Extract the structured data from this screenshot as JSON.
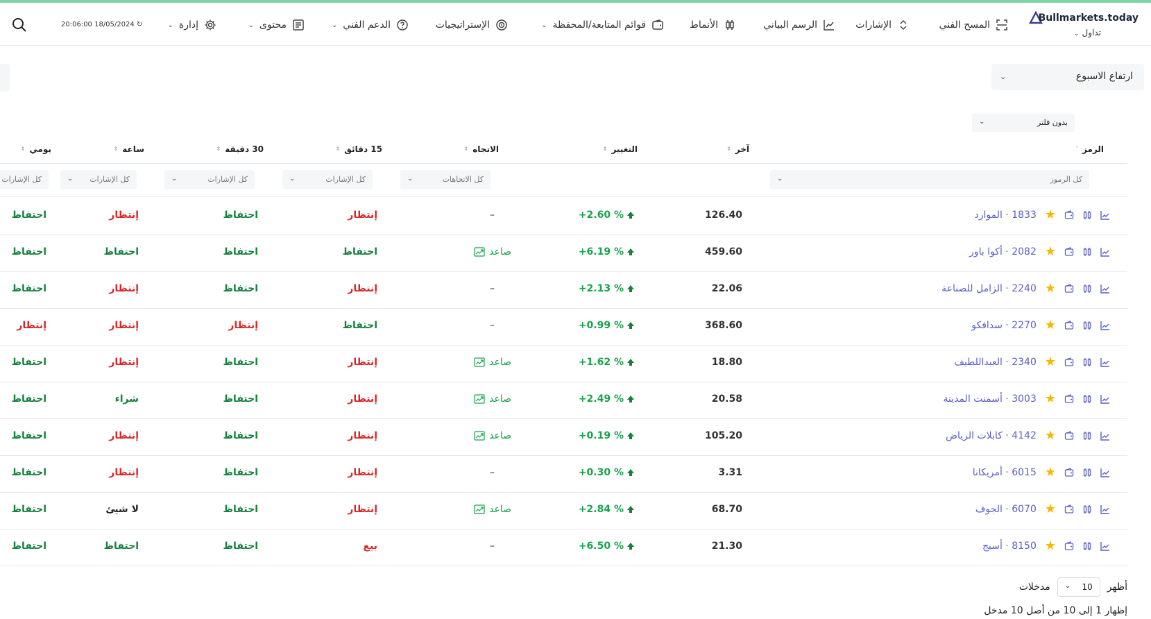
{
  "brand": {
    "name": "Bullmarkets.today",
    "sub": "تداول"
  },
  "nav": {
    "items": [
      {
        "label": "المسح الفني",
        "icon": "scan-icon",
        "caret": false
      },
      {
        "label": "الإشارات",
        "icon": "chevrons-updown-icon",
        "caret": false
      },
      {
        "label": "الرسم البياني",
        "icon": "line-chart-icon",
        "caret": false
      },
      {
        "label": "الأنماط",
        "icon": "candlestick-icon",
        "caret": false
      },
      {
        "label": "قوائم المتابعة/المحفظة",
        "icon": "wallet-icon",
        "caret": true
      },
      {
        "label": "الإستراتيجيات",
        "icon": "target-icon",
        "caret": false
      },
      {
        "label": "الدعم الفني",
        "icon": "help-icon",
        "caret": true
      },
      {
        "label": "محتوى",
        "icon": "document-icon",
        "caret": true
      },
      {
        "label": "إدارة",
        "icon": "gear-icon",
        "caret": true
      }
    ],
    "time": "20:06:00 18/05/2024"
  },
  "preset": {
    "value": "ارتفاع الاسبوع"
  },
  "filter": {
    "value": "بدون فلتر"
  },
  "table": {
    "headers": {
      "symbol": "الرمز",
      "last": "آخر",
      "change": "التغيير",
      "trend": "الاتجاه",
      "m15": "15 دقائق",
      "m30": "30 دقيقة",
      "h1": "ساعة",
      "daily": "يومي"
    },
    "filters": {
      "symbols": "كل الرموز",
      "trends": "كل الاتجاهات",
      "signals": "كل الإشارات"
    },
    "rows": [
      {
        "code": "1833",
        "name": "الموارد",
        "last": "126.40",
        "change": "+2.60 %",
        "trend": "",
        "m15": "إنتظار",
        "m30": "احتفاظ",
        "h1": "إنتظار",
        "d": "احتفاظ"
      },
      {
        "code": "2082",
        "name": "أكوا باور",
        "last": "459.60",
        "change": "+6.19 %",
        "trend": "صاعد",
        "m15": "احتفاظ",
        "m30": "احتفاظ",
        "h1": "احتفاظ",
        "d": "احتفاظ"
      },
      {
        "code": "2240",
        "name": "الزامل للصناعة",
        "last": "22.06",
        "change": "+2.13 %",
        "trend": "",
        "m15": "إنتظار",
        "m30": "احتفاظ",
        "h1": "إنتظار",
        "d": "احتفاظ"
      },
      {
        "code": "2270",
        "name": "سدافكو",
        "last": "368.60",
        "change": "+0.99 %",
        "trend": "",
        "m15": "احتفاظ",
        "m30": "إنتظار",
        "h1": "إنتظار",
        "d": "إنتظار"
      },
      {
        "code": "2340",
        "name": "العبداللطيف",
        "last": "18.80",
        "change": "+1.62 %",
        "trend": "صاعد",
        "m15": "إنتظار",
        "m30": "احتفاظ",
        "h1": "إنتظار",
        "d": "احتفاظ"
      },
      {
        "code": "3003",
        "name": "أسمنت المدينة",
        "last": "20.58",
        "change": "+2.49 %",
        "trend": "صاعد",
        "m15": "إنتظار",
        "m30": "احتفاظ",
        "h1": "شراء",
        "d": "احتفاظ"
      },
      {
        "code": "4142",
        "name": "كابلات الرياض",
        "last": "105.20",
        "change": "+0.19 %",
        "trend": "صاعد",
        "m15": "إنتظار",
        "m30": "احتفاظ",
        "h1": "إنتظار",
        "d": "احتفاظ"
      },
      {
        "code": "6015",
        "name": "أمريكانا",
        "last": "3.31",
        "change": "+0.30 %",
        "trend": "",
        "m15": "إنتظار",
        "m30": "احتفاظ",
        "h1": "إنتظار",
        "d": "احتفاظ"
      },
      {
        "code": "6070",
        "name": "الجوف",
        "last": "68.70",
        "change": "+2.84 %",
        "trend": "صاعد",
        "m15": "إنتظار",
        "m30": "احتفاظ",
        "h1": "لا شيئ",
        "d": "احتفاظ"
      },
      {
        "code": "8150",
        "name": "أسيج",
        "last": "21.30",
        "change": "+6.50 %",
        "trend": "",
        "m15": "بيع",
        "m30": "احتفاظ",
        "h1": "احتفاظ",
        "d": "احتفاظ"
      }
    ]
  },
  "pager": {
    "show": "أظهر",
    "value": "10",
    "entries": "مدخلات"
  },
  "info": "إظهار 1 إلى 10 من أصل 10 مدخل",
  "colors": {
    "accent": "#5b5fc7",
    "positive": "#16a34a",
    "negative": "#dc2626",
    "topbar": "#7fd3a6"
  }
}
